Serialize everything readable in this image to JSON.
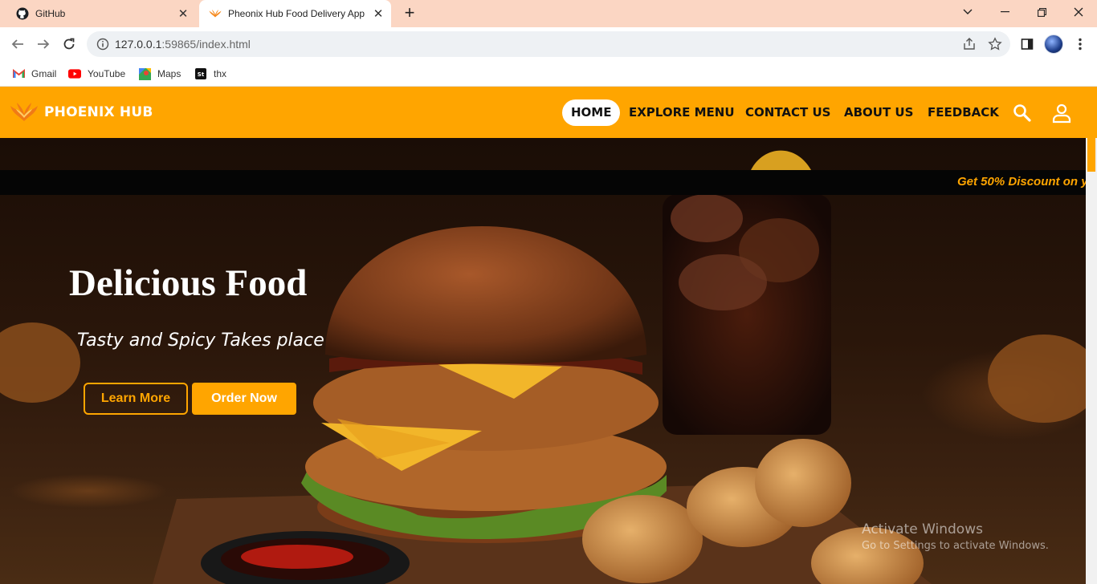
{
  "browser": {
    "tabs": [
      {
        "title": "GitHub",
        "icon": "github-icon"
      },
      {
        "title": "Pheonix Hub Food Delivery App",
        "icon": "phoenix-favicon-icon"
      }
    ],
    "new_tab_symbol": "+",
    "url_host": "127.0.0.1",
    "url_path": ":59865/index.html",
    "bookmarks": [
      {
        "label": "Gmail",
        "icon": "gmail-icon"
      },
      {
        "label": "YouTube",
        "icon": "youtube-icon"
      },
      {
        "label": "Maps",
        "icon": "maps-icon"
      },
      {
        "label": "thx",
        "icon": "st-icon"
      }
    ]
  },
  "header": {
    "brand": "PHOENIX HUB",
    "nav": [
      "HOME",
      "EXPLORE MENU",
      "CONTACT US",
      "ABOUT US",
      "FEEDBACK"
    ],
    "active_nav": "HOME"
  },
  "hero": {
    "marquee": "Get 50% Discount on y",
    "title": "Delicious Food",
    "subtitle": "Tasty and Spicy Takes place",
    "learn_more": "Learn More",
    "order_now": "Order Now"
  },
  "watermark": {
    "title": "Activate Windows",
    "subtitle": "Go to Settings to activate Windows."
  },
  "colors": {
    "accent": "#ffa500",
    "tabbar": "#fbd6c3"
  }
}
